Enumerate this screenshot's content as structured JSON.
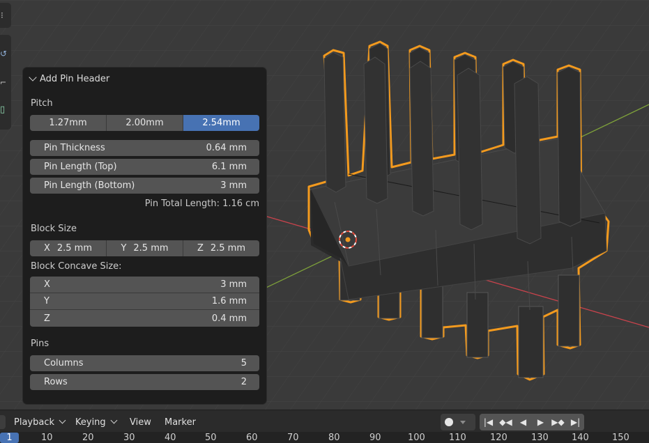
{
  "panel": {
    "title": "Add Pin Header",
    "pitch_label": "Pitch",
    "pitch_options": [
      "1.27mm",
      "2.00mm",
      "2.54mm"
    ],
    "pitch_selected": "2.54mm",
    "pin_thickness": {
      "label": "Pin Thickness",
      "value": "0.64 mm"
    },
    "pin_length_top": {
      "label": "Pin Length (Top)",
      "value": "6.1 mm"
    },
    "pin_length_bottom": {
      "label": "Pin Length (Bottom)",
      "value": "3 mm"
    },
    "pin_total_length": "Pin Total Length: 1.16 cm",
    "block_size_label": "Block Size",
    "block_size": [
      {
        "axis": "X",
        "value": "2.5 mm"
      },
      {
        "axis": "Y",
        "value": "2.5 mm"
      },
      {
        "axis": "Z",
        "value": "2.5 mm"
      }
    ],
    "block_concave_label": "Block Concave Size:",
    "block_concave": [
      {
        "axis": "X",
        "value": "3 mm"
      },
      {
        "axis": "Y",
        "value": "1.6 mm"
      },
      {
        "axis": "Z",
        "value": "0.4 mm"
      }
    ],
    "pins_label": "Pins",
    "columns": {
      "label": "Columns",
      "value": "5"
    },
    "rows": {
      "label": "Rows",
      "value": "2"
    }
  },
  "timeline": {
    "menus": [
      "Playback",
      "Keying",
      "View",
      "Marker"
    ],
    "current_frame": "1",
    "ruler_ticks": [
      "10",
      "20",
      "30",
      "40",
      "50",
      "60",
      "70",
      "80",
      "90",
      "100",
      "110",
      "120",
      "130",
      "140",
      "150"
    ]
  },
  "colors": {
    "accent": "#4772b3",
    "selection_outline": "#f39a1e",
    "x_axis": "#c8434c",
    "y_axis": "#7ea13a"
  },
  "icons": [
    "chevron-down-icon",
    "record-icon",
    "jump-start-icon",
    "prev-keyframe-icon",
    "play-reverse-icon",
    "play-icon",
    "next-keyframe-icon",
    "jump-end-icon",
    "3d-cursor-icon"
  ]
}
